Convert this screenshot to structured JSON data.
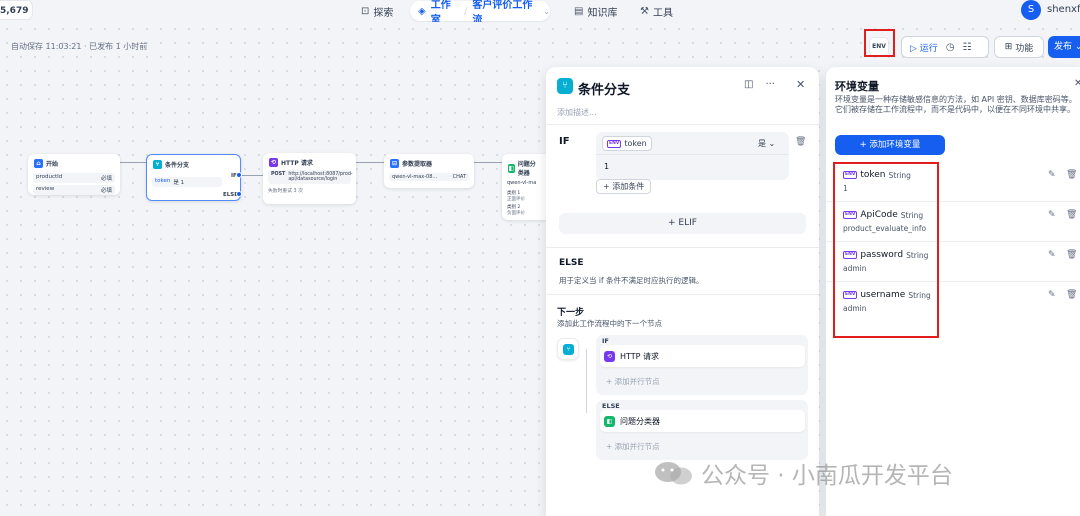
{
  "topbar": {
    "stars": "5,679",
    "nav": {
      "explore": "探索",
      "studio": "工作室",
      "workflow_name": "客户评价工作流",
      "knowledge": "知识库",
      "tools": "工具"
    },
    "user": {
      "initial": "S",
      "name": "shenxf"
    }
  },
  "toolbar": {
    "autosave": "自动保存 11:03:21 · 已发布 1 小时前",
    "env_label": "ENV",
    "run_label": "运行",
    "features_label": "功能",
    "publish_label": "发布"
  },
  "canvas_nodes": {
    "start": {
      "title": "开始",
      "vars": [
        {
          "name": "productId",
          "tag": "必填"
        },
        {
          "name": "review",
          "tag": "必填"
        }
      ]
    },
    "branch": {
      "title": "条件分支",
      "cond_var": "token",
      "cond_text": "是 1",
      "if": "IF",
      "else": "ELSE"
    },
    "http": {
      "title": "HTTP 请求",
      "method": "POST",
      "url": "http://localhost:8087/prod-api/datasource/login",
      "retry": "失败时重试 3 次"
    },
    "extract": {
      "title": "参数提取器",
      "model": "qwen-vl-max-08...",
      "tag": "CHAT"
    },
    "classify": {
      "title": "问题分类器",
      "model": "qwen-vl-ma",
      "class1": "类别 1",
      "class1_desc": "正面评价",
      "class2": "类别 2",
      "class2_desc": "负面评价"
    }
  },
  "branch_panel": {
    "title": "条件分支",
    "desc_placeholder": "添加描述...",
    "if_label": "IF",
    "condition": {
      "variable": "token",
      "operator": "是",
      "value": "1"
    },
    "add_condition": "+ 添加条件",
    "elif": "+ ELIF",
    "else_label": "ELSE",
    "else_desc": "用于定义当 if 条件不满足时应执行的逻辑。",
    "next_label": "下一步",
    "next_desc": "添加此工作流程中的下一个节点",
    "branches": [
      {
        "label": "IF",
        "node": "HTTP 请求",
        "add": "添加并行节点"
      },
      {
        "label": "ELSE",
        "node": "问题分类器",
        "add": "添加并行节点"
      }
    ]
  },
  "env_panel": {
    "title": "环境变量",
    "desc": "环境变量是一种存储敏感信息的方法，如 API 密钥、数据库密码等。它们被存储在工作流程中，而不是代码中，以便在不同环境中共享。",
    "add_button": "+ 添加环境变量",
    "variables": [
      {
        "name": "token",
        "type": "String",
        "value": "1"
      },
      {
        "name": "ApiCode",
        "type": "String",
        "value": "product_evaluate_info"
      },
      {
        "name": "password",
        "type": "String",
        "value": "admin"
      },
      {
        "name": "username",
        "type": "String",
        "value": "admin"
      }
    ]
  },
  "watermark": "公众号 · 小南瓜开发平台",
  "colors": {
    "accent": "#155eef",
    "highlight": "#e11d1d",
    "branch_icon": "#06aed4",
    "env_tag": "#7839ee"
  }
}
